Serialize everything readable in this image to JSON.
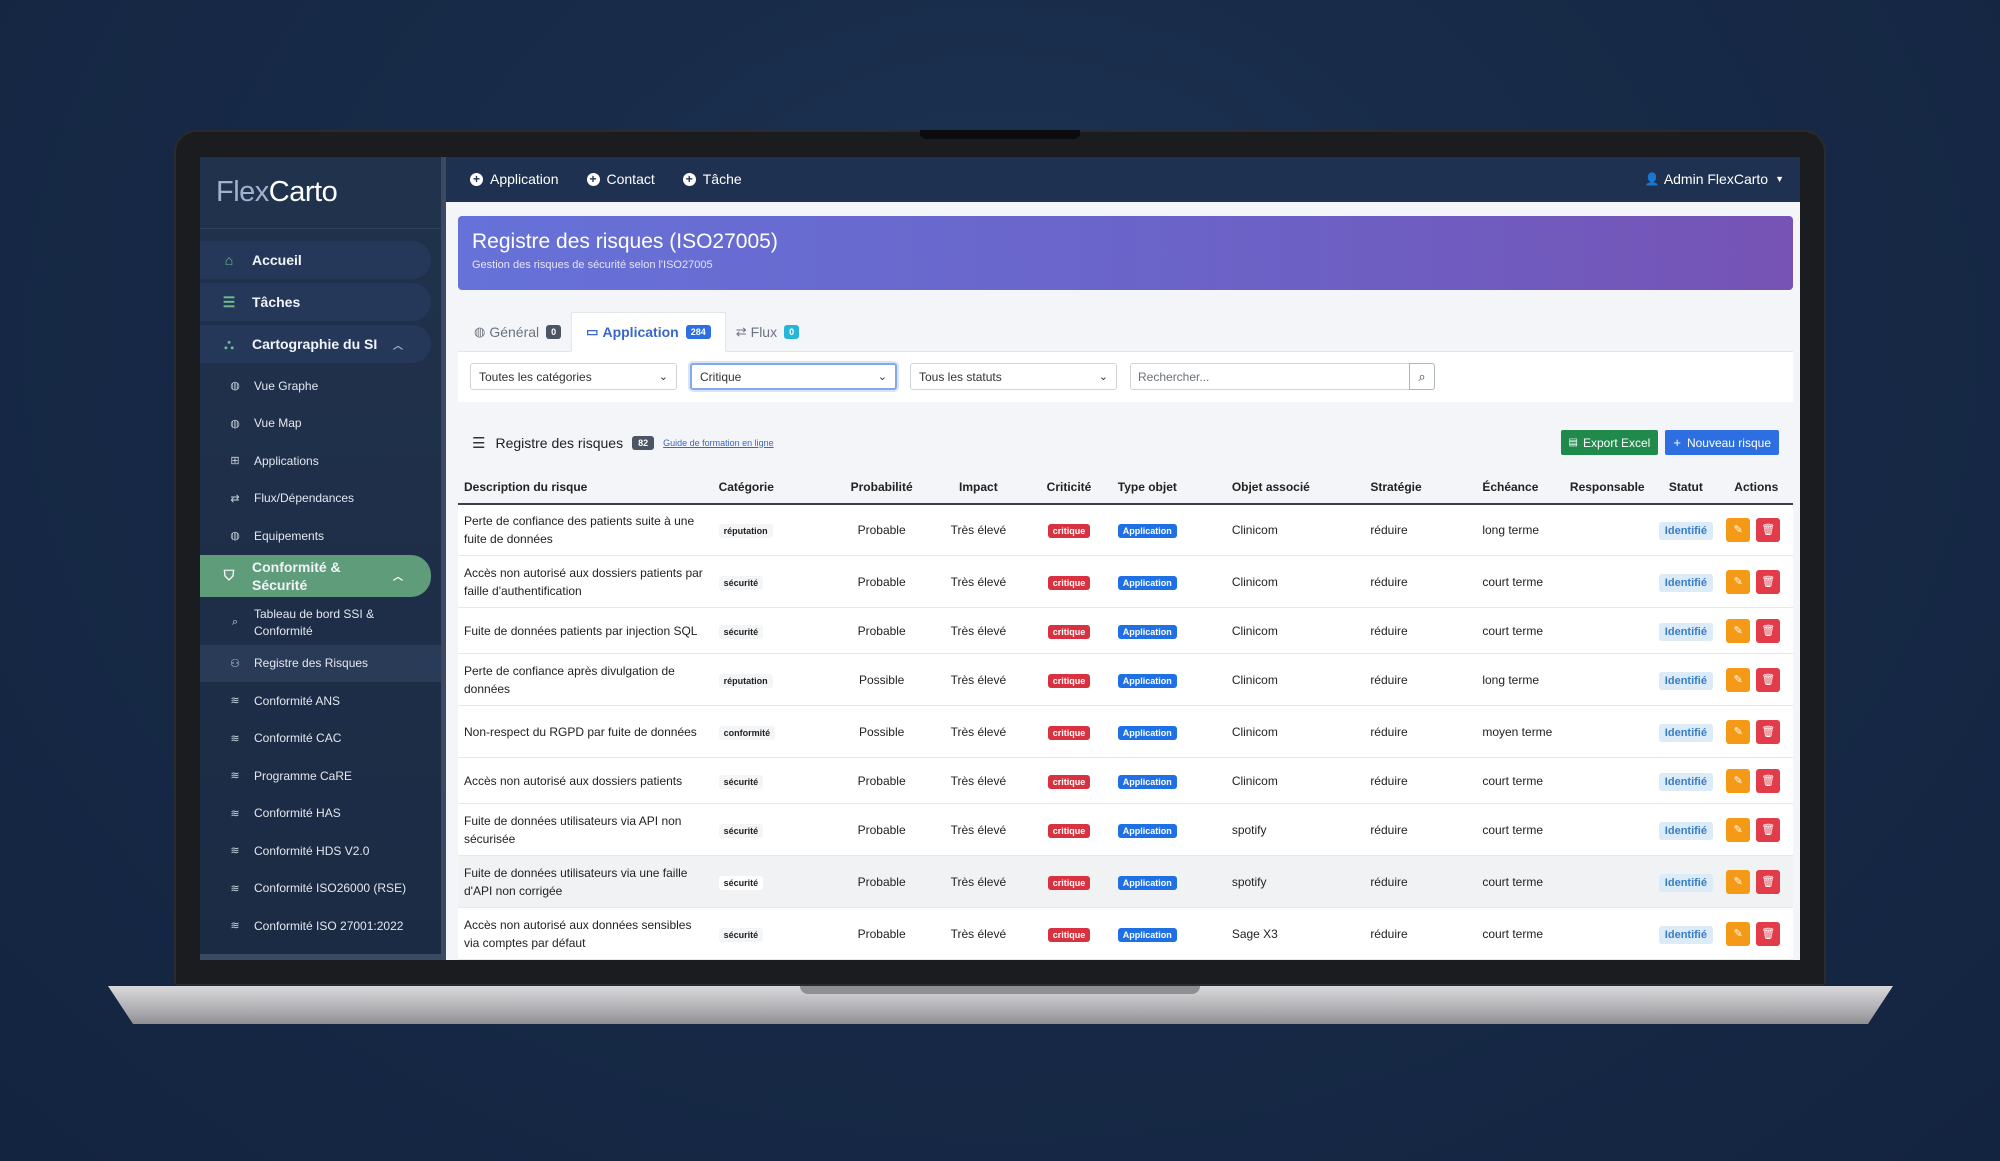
{
  "app": {
    "logo_part1": "Flex",
    "logo_part2": "Carto"
  },
  "sidebar": {
    "items": [
      {
        "label": "Accueil",
        "icon": "home-icon",
        "glyph": "⌂"
      },
      {
        "label": "Tâches",
        "icon": "task-list-icon",
        "glyph": "☰"
      },
      {
        "label": "Cartographie du SI",
        "icon": "sitemap-icon",
        "glyph": "⛬"
      }
    ],
    "carto_sub": [
      {
        "label": "Vue Graphe",
        "icon": "globe-icon"
      },
      {
        "label": "Vue Map",
        "icon": "globe-icon"
      },
      {
        "label": "Applications",
        "icon": "grid-icon"
      },
      {
        "label": "Flux/Dépendances",
        "icon": "exchange-icon"
      },
      {
        "label": "Equipements",
        "icon": "globe-icon"
      }
    ],
    "compliance": {
      "label_line1": "Conformité &",
      "label_line2": "Sécurité",
      "icon": "shield-icon"
    },
    "compliance_sub": [
      {
        "label_line1": "Tableau de bord SSI &",
        "label_line2": "Conformité",
        "icon": "search-icon"
      },
      {
        "label": "Registre des Risques",
        "icon": "user-cog-icon"
      },
      {
        "label": "Conformité ANS",
        "icon": "layers-icon"
      },
      {
        "label": "Conformité CAC",
        "icon": "layers-icon"
      },
      {
        "label": "Programme CaRE",
        "icon": "layers-icon"
      },
      {
        "label": "Conformité HAS",
        "icon": "layers-icon"
      },
      {
        "label": "Conformité HDS V2.0",
        "icon": "layers-icon"
      },
      {
        "label": "Conformité ISO26000 (RSE)",
        "icon": "layers-icon"
      },
      {
        "label": "Conformité ISO 27001:2022",
        "icon": "layers-icon"
      }
    ]
  },
  "topbar": {
    "links": [
      "Application",
      "Contact",
      "Tâche"
    ],
    "user": "Admin FlexCarto"
  },
  "banner": {
    "title": "Registre des risques (ISO27005)",
    "subtitle": "Gestion des risques de sécurité selon l'ISO27005"
  },
  "tabs": [
    {
      "label": "Général",
      "count": "0",
      "icon": "globe-icon",
      "badge_color": "#4b5563"
    },
    {
      "label": "Application",
      "count": "284",
      "icon": "monitor-icon",
      "badge_color": "#2d6fe0"
    },
    {
      "label": "Flux",
      "count": "0",
      "icon": "exchange-icon",
      "badge_color": "#27b6d8"
    }
  ],
  "filters": {
    "category": "Toutes les catégories",
    "criticality": "Critique",
    "status": "Tous les statuts",
    "search_placeholder": "Rechercher..."
  },
  "register": {
    "title": "Registre des risques",
    "count": "82",
    "guide_link": "Guide de formation en ligne",
    "export_label": "Export Excel",
    "new_label": "Nouveau risque"
  },
  "table": {
    "columns": [
      "Description du risque",
      "Catégorie",
      "Probabilité",
      "Impact",
      "Criticité",
      "Type objet",
      "Objet associé",
      "Stratégie",
      "Échéance",
      "Responsable",
      "Statut",
      "Actions"
    ],
    "rows": [
      {
        "desc": "Perte de confiance des patients suite à une fuite de données",
        "cat": "réputation",
        "prob": "Probable",
        "impact": "Très élevé",
        "crit": "critique",
        "type": "Application",
        "obj": "Clinicom",
        "strat": "réduire",
        "ech": "long terme",
        "resp": "",
        "statut": "Identifié"
      },
      {
        "desc": "Accès non autorisé aux dossiers patients par faille d'authentification",
        "cat": "sécurité",
        "prob": "Probable",
        "impact": "Très élevé",
        "crit": "critique",
        "type": "Application",
        "obj": "Clinicom",
        "strat": "réduire",
        "ech": "court terme",
        "resp": "",
        "statut": "Identifié"
      },
      {
        "desc": "Fuite de données patients par injection SQL",
        "cat": "sécurité",
        "prob": "Probable",
        "impact": "Très élevé",
        "crit": "critique",
        "type": "Application",
        "obj": "Clinicom",
        "strat": "réduire",
        "ech": "court terme",
        "resp": "",
        "statut": "Identifié"
      },
      {
        "desc": "Perte de confiance après divulgation de données",
        "cat": "réputation",
        "prob": "Possible",
        "impact": "Très élevé",
        "crit": "critique",
        "type": "Application",
        "obj": "Clinicom",
        "strat": "réduire",
        "ech": "long terme",
        "resp": "",
        "statut": "Identifié"
      },
      {
        "desc": "Non-respect du RGPD par fuite de données",
        "cat": "conformité",
        "prob": "Possible",
        "impact": "Très élevé",
        "crit": "critique",
        "type": "Application",
        "obj": "Clinicom",
        "strat": "réduire",
        "ech": "moyen terme",
        "resp": "",
        "statut": "Identifié"
      },
      {
        "desc": "Accès non autorisé aux dossiers patients",
        "cat": "sécurité",
        "prob": "Probable",
        "impact": "Très élevé",
        "crit": "critique",
        "type": "Application",
        "obj": "Clinicom",
        "strat": "réduire",
        "ech": "court terme",
        "resp": "",
        "statut": "Identifié"
      },
      {
        "desc": "Fuite de données utilisateurs via API non sécurisée",
        "cat": "sécurité",
        "prob": "Probable",
        "impact": "Très élevé",
        "crit": "critique",
        "type": "Application",
        "obj": "spotify",
        "strat": "réduire",
        "ech": "court terme",
        "resp": "",
        "statut": "Identifié"
      },
      {
        "desc": "Fuite de données utilisateurs via une faille d'API non corrigée",
        "cat": "sécurité",
        "prob": "Probable",
        "impact": "Très élevé",
        "crit": "critique",
        "type": "Application",
        "obj": "spotify",
        "strat": "réduire",
        "ech": "court terme",
        "resp": "",
        "statut": "Identifié"
      },
      {
        "desc": "Accès non autorisé aux données sensibles via comptes par défaut",
        "cat": "sécurité",
        "prob": "Probable",
        "impact": "Très élevé",
        "crit": "critique",
        "type": "Application",
        "obj": "Sage X3",
        "strat": "réduire",
        "ech": "court terme",
        "resp": "",
        "statut": "Identifié"
      }
    ]
  },
  "colors": {
    "sidebar_active": "#5f9c7a",
    "critique": "#d8313f",
    "application": "#1f6fe5",
    "export": "#1f8a4c",
    "new": "#2d6fe0"
  }
}
